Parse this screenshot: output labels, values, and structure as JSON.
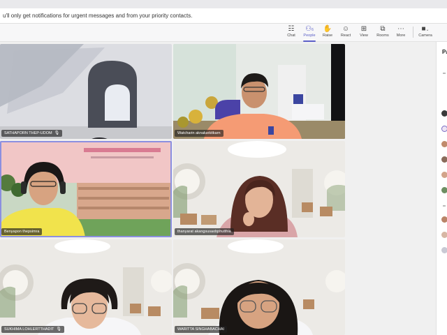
{
  "notification": {
    "text": "u'll only get notifications for urgent messages and from your priority contacts."
  },
  "toolbar": {
    "buttons": [
      {
        "id": "chat",
        "label": "Chat",
        "icon": "chat-icon",
        "glyph": "☷"
      },
      {
        "id": "people",
        "label": "People",
        "icon": "people-icon",
        "glyph": "⚇"
      },
      {
        "id": "raise",
        "label": "Raise",
        "icon": "raise-hand-icon",
        "glyph": "✋"
      },
      {
        "id": "react",
        "label": "React",
        "icon": "react-icon",
        "glyph": "☺"
      },
      {
        "id": "view",
        "label": "View",
        "icon": "view-icon",
        "glyph": "⊞"
      },
      {
        "id": "rooms",
        "label": "Rooms",
        "icon": "rooms-icon",
        "glyph": "⧉"
      },
      {
        "id": "more",
        "label": "More",
        "icon": "more-icon",
        "glyph": "⋯"
      },
      {
        "id": "camera",
        "label": "Camera",
        "icon": "camera-icon",
        "glyph": "■"
      }
    ],
    "people_count": "6",
    "accent": "#5b5fc7"
  },
  "participants": [
    {
      "name": "SATHAPORN THEP-UDOM"
    },
    {
      "name": "Watcharin aknaluekitkarn"
    },
    {
      "name": "Benyapon thepsimra"
    },
    {
      "name": "thanyarat akangsusaobphutthia"
    },
    {
      "name": "SUKHIMA LOHLERTTHADIT"
    },
    {
      "name": "WARITTA SINGHABACHAI"
    }
  ],
  "panel": {
    "title": "Pa"
  }
}
